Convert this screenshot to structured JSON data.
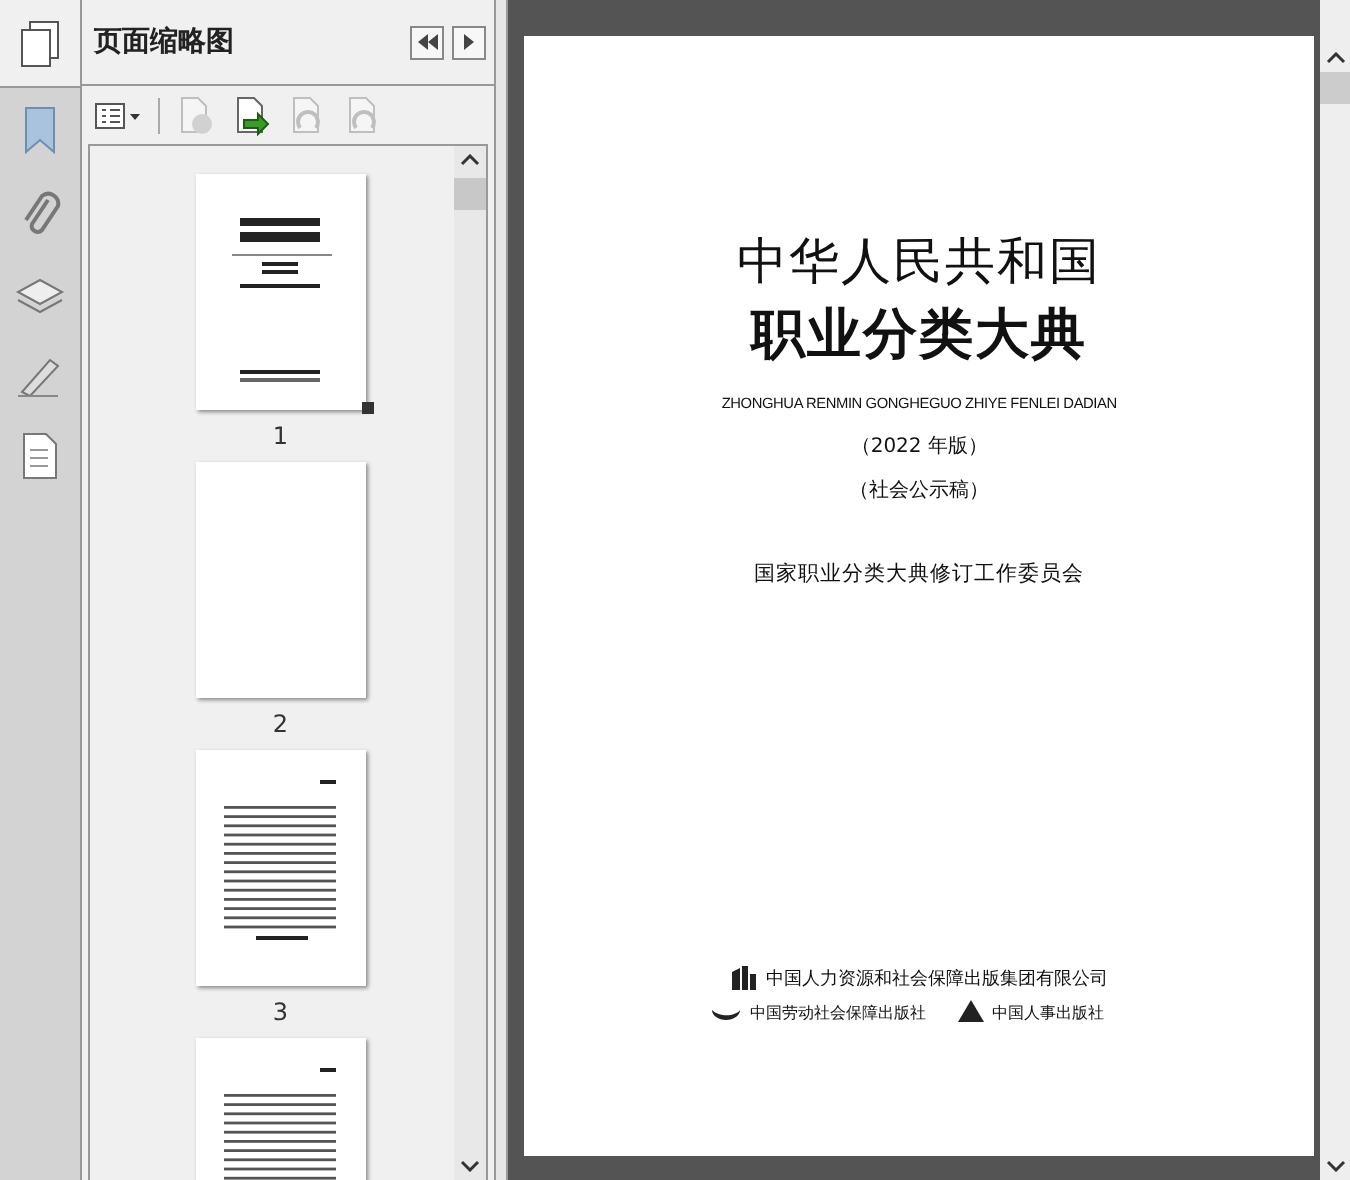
{
  "panel": {
    "title": "页面缩略图"
  },
  "rail": [
    {
      "kind": "bookmark"
    },
    {
      "kind": "attachment"
    },
    {
      "kind": "layers"
    },
    {
      "kind": "signature"
    },
    {
      "kind": "document"
    }
  ],
  "toolbar": [
    {
      "kind": "options",
      "disabled": false
    },
    {
      "kind": "delete",
      "disabled": true
    },
    {
      "kind": "insert",
      "disabled": false
    },
    {
      "kind": "undo",
      "disabled": true
    },
    {
      "kind": "redo",
      "disabled": true
    }
  ],
  "thumbnails": [
    {
      "label": "1",
      "kind": "cover",
      "selected": true
    },
    {
      "label": "2",
      "kind": "blank",
      "selected": false
    },
    {
      "label": "3",
      "kind": "contents",
      "selected": false
    },
    {
      "kind": "contents",
      "selected": false
    }
  ],
  "page": {
    "title_line_1": "中华人民共和国",
    "title_line_2": "职业分类大典",
    "pinyin": "ZHONGHUA RENMIN GONGHEGUO ZHIYE FENLEI DADIAN",
    "edition": "（2022 年版）",
    "draft": "（社会公示稿）",
    "committee": "国家职业分类大典修订工作委员会",
    "publisher": "中国人力资源和社会保障出版集团有限公司",
    "imprints": [
      "中国劳动社会保障出版社",
      "中国人事出版社"
    ]
  }
}
